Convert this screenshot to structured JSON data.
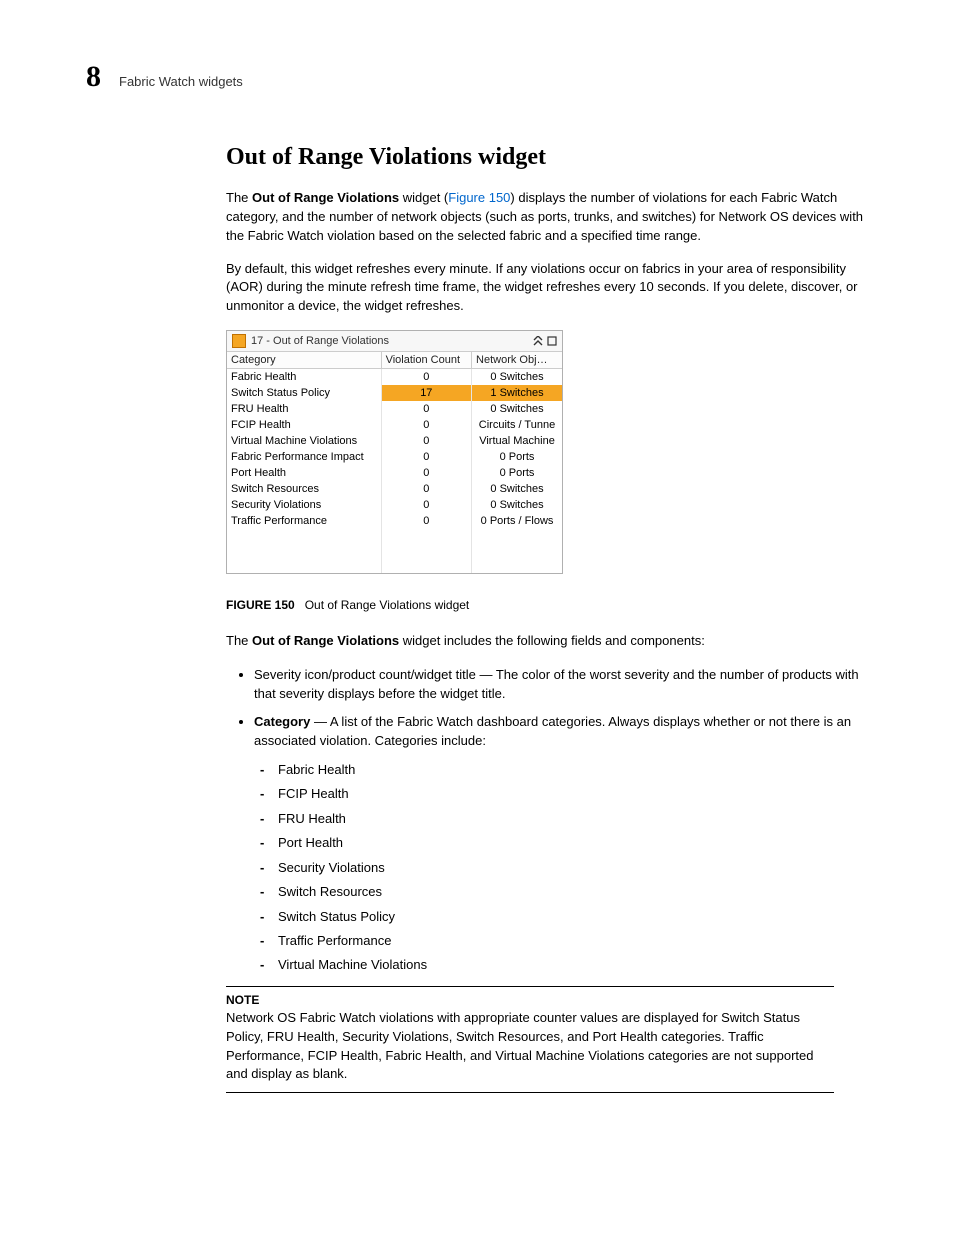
{
  "header": {
    "chapter": "8",
    "title": "Fabric Watch widgets"
  },
  "section": {
    "heading": "Out of Range Violations widget",
    "para1_prefix": "The ",
    "para1_bold": "Out of Range Violations",
    "para1_mid": " widget (",
    "para1_link": "Figure 150",
    "para1_suffix": ") displays the number of violations for each Fabric Watch category, and the number of network objects (such as ports, trunks, and switches) for Network OS devices with the Fabric Watch violation based on the selected fabric and a specified time range.",
    "para2": "By default, this widget refreshes every minute. If any violations occur on fabrics in your area of responsibility (AOR) during the minute refresh time frame, the widget refreshes every 10 seconds. If you delete, discover, or unmonitor a device, the widget refreshes."
  },
  "widget": {
    "title": "17 - Out of Range Violations",
    "columns": {
      "c1": "Category",
      "c2": "Violation Count",
      "c3": "Network Obj…"
    }
  },
  "chart_data": {
    "type": "table",
    "columns": [
      "Category",
      "Violation Count",
      "Network Obj"
    ],
    "rows": [
      {
        "category": "Fabric Health",
        "count": "0",
        "obj": "0 Switches",
        "highlight": false
      },
      {
        "category": "Switch Status Policy",
        "count": "17",
        "obj": "1 Switches",
        "highlight": true
      },
      {
        "category": "FRU Health",
        "count": "0",
        "obj": "0 Switches",
        "highlight": false
      },
      {
        "category": "FCIP Health",
        "count": "0",
        "obj": "Circuits / Tunne",
        "highlight": false
      },
      {
        "category": "Virtual Machine Violations",
        "count": "0",
        "obj": "Virtual Machine",
        "highlight": false
      },
      {
        "category": "Fabric Performance Impact",
        "count": "0",
        "obj": "0 Ports",
        "highlight": false
      },
      {
        "category": "Port Health",
        "count": "0",
        "obj": "0 Ports",
        "highlight": false
      },
      {
        "category": "Switch Resources",
        "count": "0",
        "obj": "0 Switches",
        "highlight": false
      },
      {
        "category": "Security Violations",
        "count": "0",
        "obj": "0 Switches",
        "highlight": false
      },
      {
        "category": "Traffic Performance",
        "count": "0",
        "obj": "0 Ports / Flows",
        "highlight": false
      }
    ]
  },
  "figure": {
    "label": "FIGURE 150",
    "caption": "Out of Range Violations widget"
  },
  "after_figure": {
    "para_prefix": "The ",
    "para_bold": "Out of Range Violations",
    "para_suffix": " widget includes the following fields and components:"
  },
  "bullets": {
    "b1": "Severity icon/product count/widget title — The color of the worst severity and the number of products with that severity displays before the widget title.",
    "b2_bold": "Category",
    "b2_rest": " — A list of the Fabric Watch dashboard categories. Always displays whether or not there is an associated violation. Categories include:",
    "dashes": [
      "Fabric Health",
      "FCIP Health",
      "FRU Health",
      "Port Health",
      "Security Violations",
      "Switch Resources",
      "Switch Status Policy",
      "Traffic Performance",
      "Virtual Machine Violations"
    ]
  },
  "note": {
    "label": "NOTE",
    "text": "Network OS Fabric Watch violations with appropriate counter values are displayed for Switch Status Policy, FRU Health, Security Violations, Switch Resources, and Port Health categories. Traffic Performance, FCIP Health, Fabric Health, and Virtual Machine Violations categories are not supported and display as blank."
  }
}
